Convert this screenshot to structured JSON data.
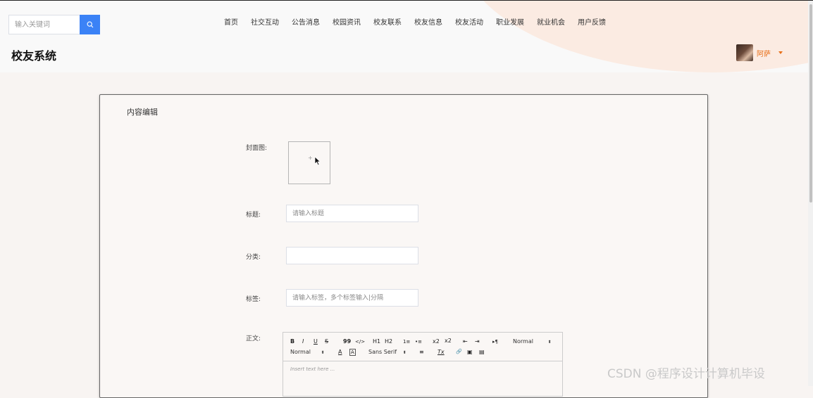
{
  "header": {
    "search_placeholder": "输入关键词",
    "site_title": "校友系统",
    "nav": [
      "首页",
      "社交互动",
      "公告消息",
      "校园资讯",
      "校友联系",
      "校友信息",
      "校友活动",
      "职业发展",
      "就业机会",
      "用户反馈"
    ],
    "username": "阿萨"
  },
  "form": {
    "section_title": "内容编辑",
    "cover_label": "封面图:",
    "title_label": "标题:",
    "title_placeholder": "请输入标题",
    "category_label": "分类:",
    "category_value": "",
    "tags_label": "标签:",
    "tags_placeholder": "请输入标签，多个标签输入|分隔",
    "body_label": "正文:"
  },
  "editor": {
    "toolbar": {
      "bold": "B",
      "italic": "I",
      "underline": "U",
      "strike": "S",
      "blockquote": "99",
      "code": "</>",
      "h1": "H1",
      "h2": "H2",
      "ordered_list": "1≡",
      "bullet_list": "•≡",
      "subscript": "x2",
      "superscript": "x2",
      "outdent": "⇤",
      "indent": "⇥",
      "direction": "▸¶",
      "size_select": "Normal",
      "header_select": "Normal",
      "font_select": "Sans Serif",
      "color": "A",
      "background": "A",
      "align": "≡",
      "clean": "Tx",
      "link": "🔗",
      "image": "▣",
      "video": "▤"
    },
    "placeholder": "Insert text here ..."
  },
  "watermark": "CSDN @程序设计计算机毕设",
  "colors": {
    "accent_blue": "#3b82f6",
    "accent_orange": "#e8701a"
  }
}
